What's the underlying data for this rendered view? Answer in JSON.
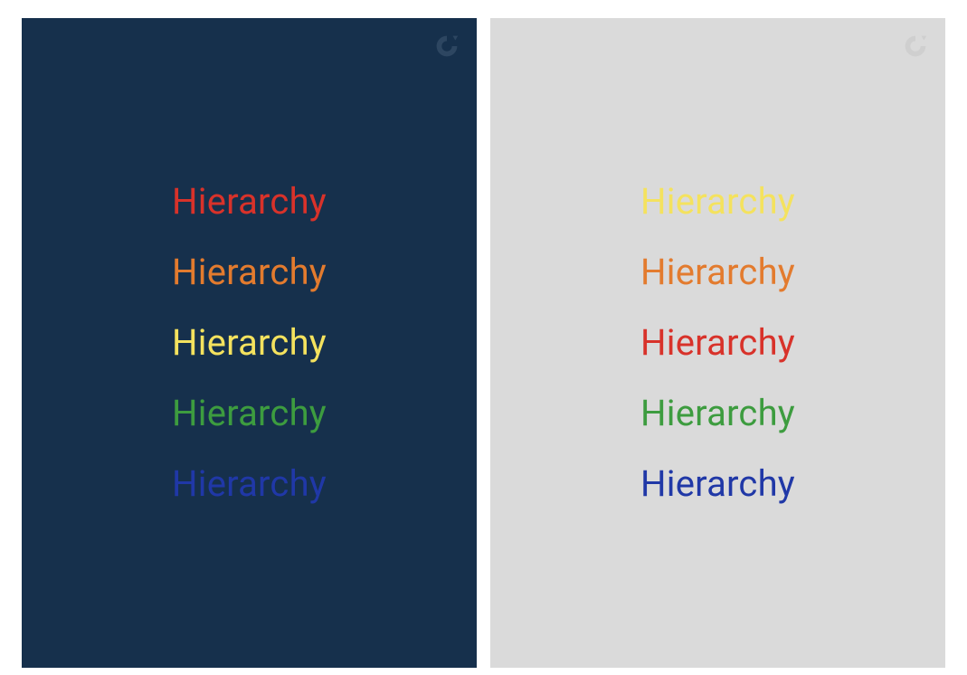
{
  "word": "Hierarchy",
  "colors": {
    "red": "#d8322a",
    "orange": "#e37b2e",
    "yellow": "#f4e25e",
    "green": "#3d9c3f",
    "blue": "#2038a7"
  },
  "panels": [
    {
      "bg": "dark",
      "order": [
        "red",
        "orange",
        "yellow",
        "green",
        "blue"
      ],
      "logoColor": "#4a627b"
    },
    {
      "bg": "light",
      "order": [
        "yellow",
        "orange",
        "red",
        "green",
        "blue"
      ],
      "logoColor": "#cfcfcf"
    }
  ]
}
